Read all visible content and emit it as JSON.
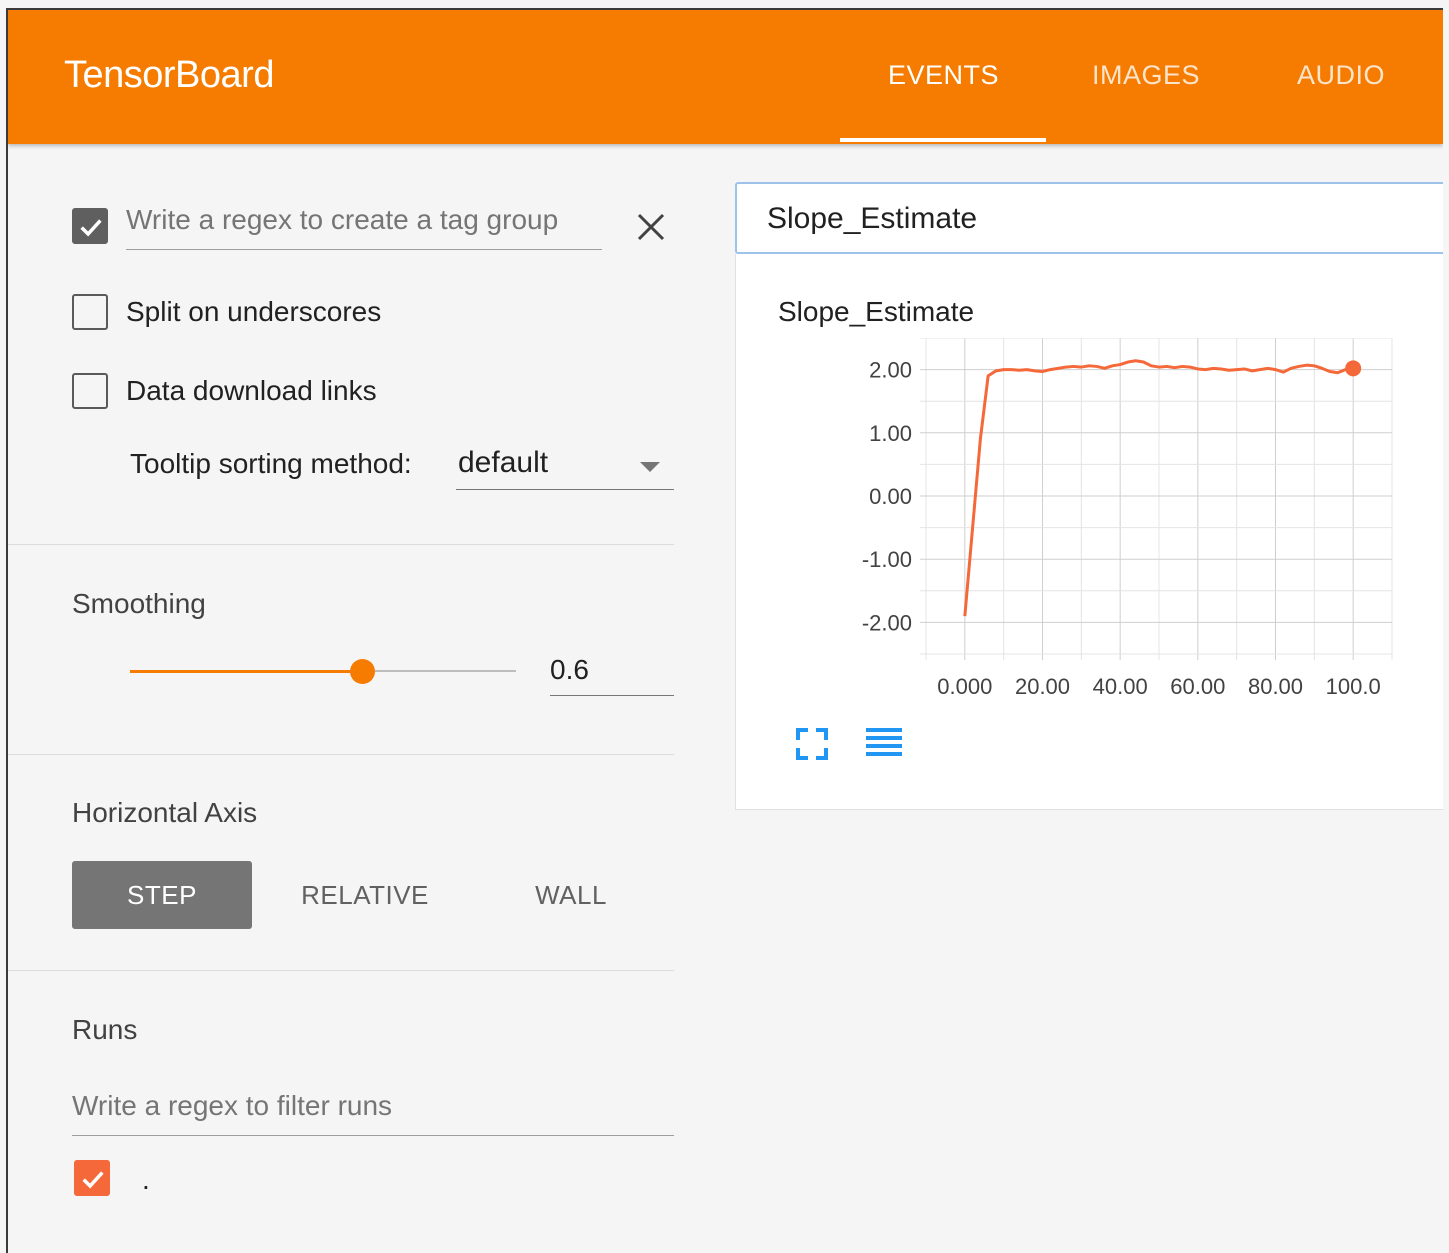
{
  "header": {
    "app_title": "TensorBoard",
    "tabs": [
      {
        "label": "EVENTS",
        "active": true
      },
      {
        "label": "IMAGES",
        "active": false
      },
      {
        "label": "AUDIO",
        "active": false
      }
    ],
    "color": "#f57c00"
  },
  "sidebar": {
    "tag_group_enabled": true,
    "tag_group_placeholder": "Write a regex to create a tag group",
    "split_underscores_label": "Split on underscores",
    "split_underscores_checked": false,
    "data_download_label": "Data download links",
    "data_download_checked": false,
    "tooltip_sort_label": "Tooltip sorting method:",
    "tooltip_sort_value": "default",
    "smoothing_title": "Smoothing",
    "smoothing_value": "0.6",
    "horizontal_axis_title": "Horizontal Axis",
    "axis_options": [
      {
        "label": "STEP",
        "active": true
      },
      {
        "label": "RELATIVE",
        "active": false
      },
      {
        "label": "WALL",
        "active": false
      }
    ],
    "runs_title": "Runs",
    "runs_filter_placeholder": "Write a regex to filter runs",
    "runs": [
      {
        "label": ".",
        "checked": true,
        "color": "#f4683a"
      }
    ]
  },
  "card": {
    "tag": "Slope_Estimate"
  },
  "chart_data": {
    "type": "line",
    "title": "Slope_Estimate",
    "xlabel": "",
    "ylabel": "",
    "x_ticks": [
      "0.000",
      "20.00",
      "40.00",
      "60.00",
      "80.00",
      "100.0"
    ],
    "y_ticks": [
      "2.00",
      "1.00",
      "0.00",
      "-1.00",
      "-2.00"
    ],
    "xlim": [
      -10,
      110
    ],
    "ylim": [
      -2.5,
      2.5
    ],
    "grid": true,
    "series": [
      {
        "color": "#f4683a",
        "x": [
          0,
          2,
          4,
          6,
          8,
          10,
          12,
          14,
          16,
          18,
          20,
          22,
          24,
          26,
          28,
          30,
          32,
          34,
          36,
          38,
          40,
          42,
          44,
          46,
          48,
          50,
          52,
          54,
          56,
          58,
          60,
          62,
          64,
          66,
          68,
          70,
          72,
          74,
          76,
          78,
          80,
          82,
          84,
          86,
          88,
          90,
          92,
          94,
          96,
          98,
          100
        ],
        "y": [
          -1.9,
          -0.5,
          0.9,
          1.9,
          1.98,
          2.0,
          2.0,
          1.99,
          2.0,
          1.98,
          1.97,
          2.0,
          2.02,
          2.04,
          2.05,
          2.04,
          2.06,
          2.05,
          2.02,
          2.06,
          2.08,
          2.12,
          2.14,
          2.12,
          2.06,
          2.04,
          2.05,
          2.03,
          2.05,
          2.04,
          2.01,
          2.0,
          2.02,
          2.01,
          1.99,
          2.0,
          2.01,
          1.98,
          2.0,
          2.02,
          2.0,
          1.96,
          2.02,
          2.05,
          2.07,
          2.06,
          2.02,
          1.97,
          1.95,
          2.0,
          2.02
        ]
      }
    ]
  }
}
